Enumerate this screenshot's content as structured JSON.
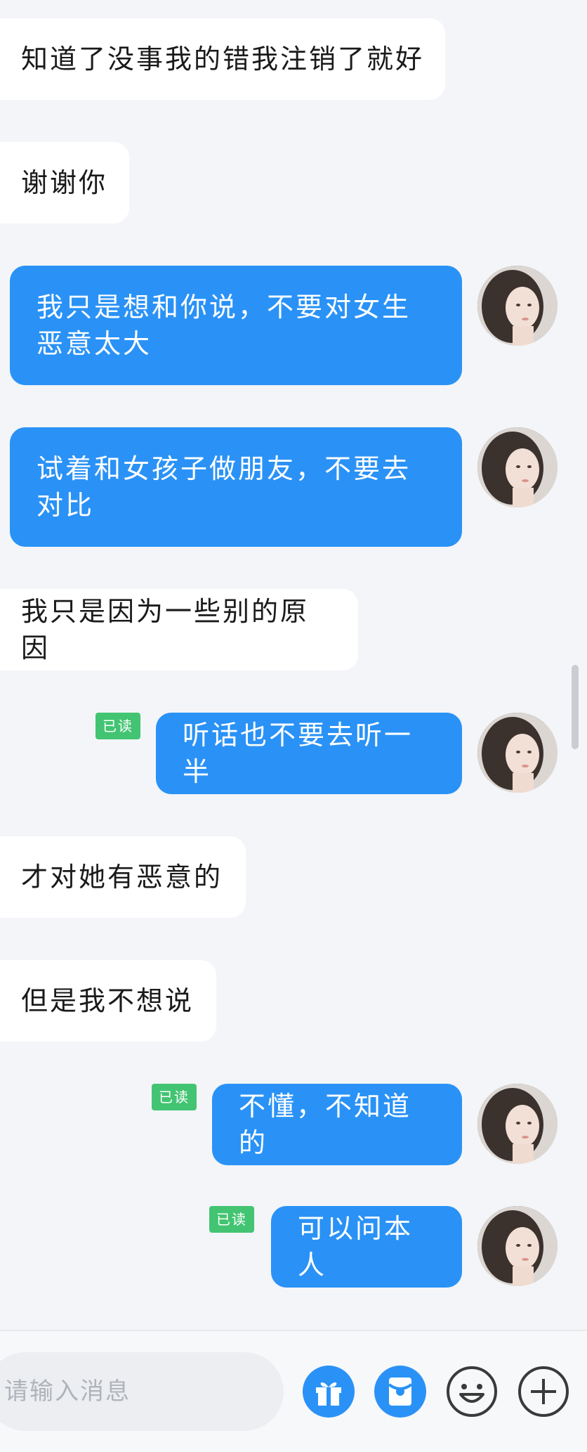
{
  "messages": [
    {
      "side": "in",
      "text": "知道了没事我的错我注销了就好"
    },
    {
      "side": "in",
      "text": "谢谢你"
    },
    {
      "side": "out",
      "text": "我只是想和你说，不要对女生恶意太大"
    },
    {
      "side": "out",
      "text": "试着和女孩子做朋友，不要去对比"
    },
    {
      "side": "in",
      "text": "我只是因为一些别的原因"
    },
    {
      "side": "out",
      "text": "听话也不要去听一半",
      "read": "已读"
    },
    {
      "side": "in",
      "text": "才对她有恶意的"
    },
    {
      "side": "in",
      "text": "但是我不想说"
    },
    {
      "side": "out",
      "text": "不懂，不知道的",
      "read": "已读"
    },
    {
      "side": "out",
      "text": "可以问本人",
      "read": "已读"
    }
  ],
  "composer": {
    "placeholder": "请输入消息",
    "tools": [
      "gift-icon",
      "red-packet-icon",
      "emoji-icon",
      "plus-icon"
    ]
  },
  "colors": {
    "background": "#f3f5f8",
    "outgoing_bubble": "#2a92f6",
    "incoming_bubble": "#ffffff",
    "read_badge": "#43c472"
  }
}
